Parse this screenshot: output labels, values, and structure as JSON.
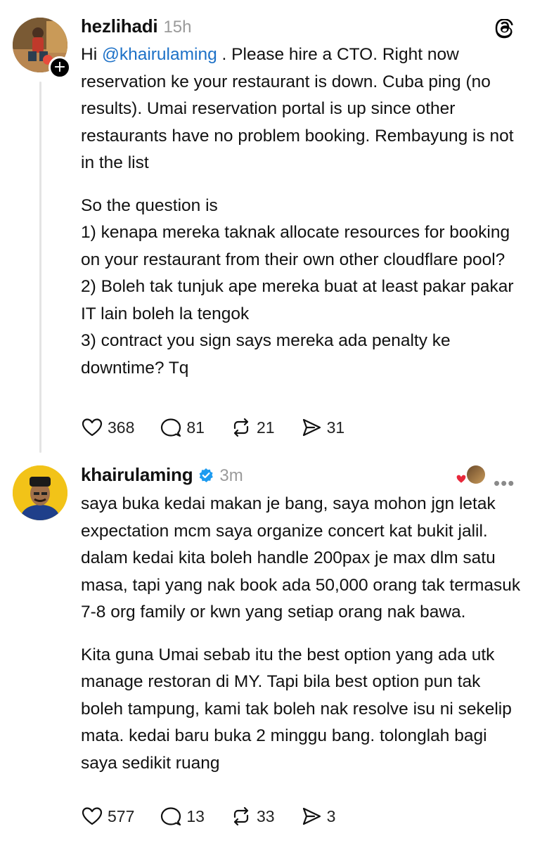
{
  "app": {
    "logo_icon": "threads-logo-icon"
  },
  "post1": {
    "username": "hezlihadi",
    "time": "15h",
    "mention": "@khairulaming",
    "text_before_mention": "Hi ",
    "text_after_mention": " . Please hire a CTO. Right now reservation ke your restaurant is down. Cuba ping (no results). Umai reservation portal is up since other restaurants have no problem booking. Rembayung is not in the list",
    "paragraph2": "So the question is",
    "list": [
      "1) kenapa mereka taknak allocate resources for booking on your restaurant from their own other cloudflare pool?",
      "2) Boleh tak tunjuk ape mereka buat at least pakar pakar IT lain boleh la tengok",
      "3) contract you sign says mereka ada penalty ke downtime? Tq"
    ],
    "likes": "368",
    "replies": "81",
    "reposts": "21",
    "shares": "31",
    "follow_badge": "+"
  },
  "post2": {
    "username": "khairulaming",
    "time": "3m",
    "paragraph1": "saya buka kedai makan je bang, saya mohon jgn letak expectation mcm saya organize concert kat bukit jalil. dalam kedai kita boleh handle 200pax je max dlm satu masa, tapi yang nak book ada 50,000 orang tak termasuk 7-8 org family or kwn yang setiap orang nak bawa.",
    "paragraph2": "Kita guna Umai sebab itu the best option yang ada utk manage restoran di MY. Tapi bila best option pun tak boleh tampung, kami tak boleh nak resolve isu ni sekelip mata. kedai baru buka 2 minggu bang. tolonglah bagi saya sedikit ruang",
    "likes": "577",
    "replies": "13",
    "reposts": "33",
    "shares": "3",
    "more_label": "•••"
  },
  "colors": {
    "mention": "#1d71c7",
    "verified": "#1d9bf0",
    "muted": "#9a9a9a",
    "reaction_heart": "#e8283b"
  }
}
